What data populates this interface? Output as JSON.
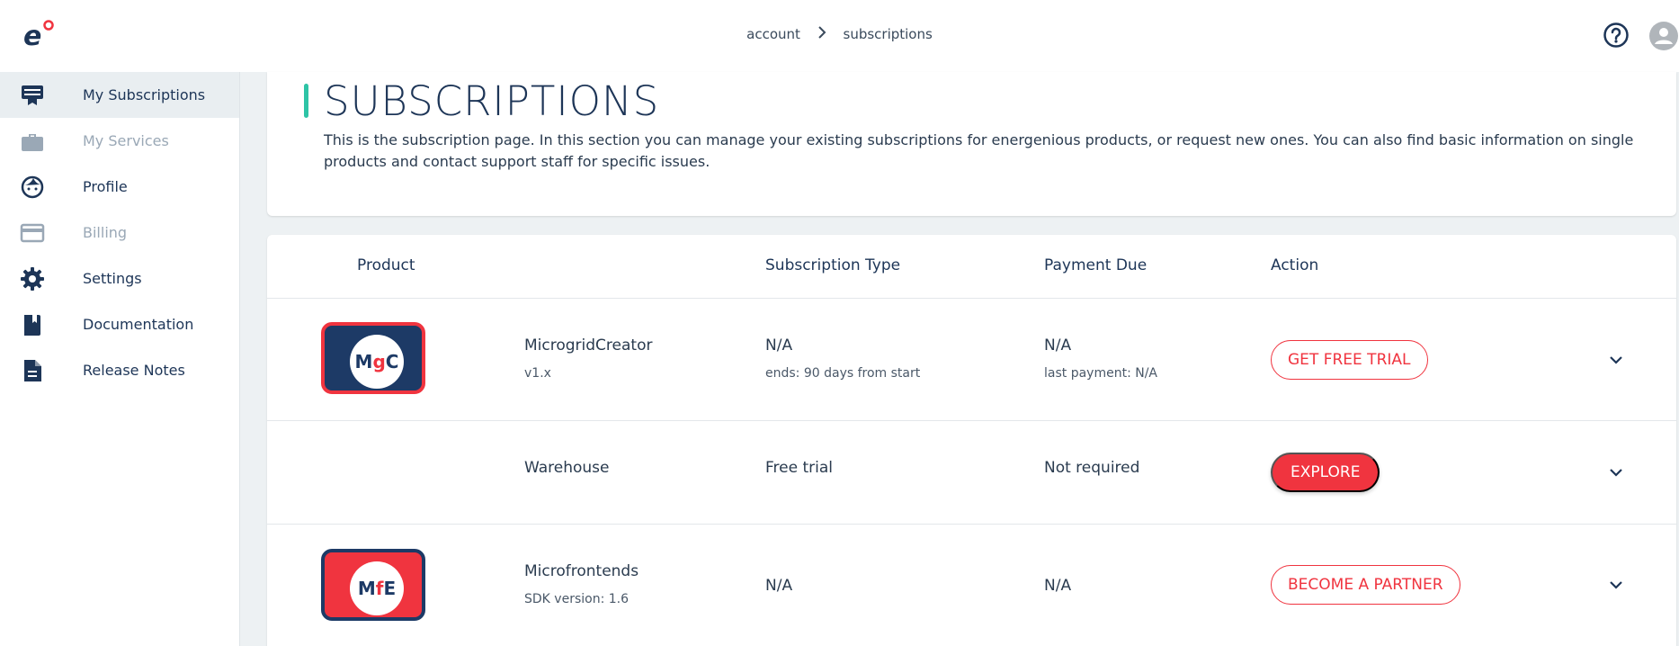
{
  "breadcrumb": {
    "items": [
      "account",
      "subscriptions"
    ]
  },
  "sidebar": {
    "items": [
      {
        "label": "My Subscriptions",
        "icon": "subscriptions-icon",
        "active": true,
        "disabled": false
      },
      {
        "label": "My Services",
        "icon": "briefcase-icon",
        "active": false,
        "disabled": true
      },
      {
        "label": "Profile",
        "icon": "face-icon",
        "active": false,
        "disabled": false
      },
      {
        "label": "Billing",
        "icon": "credit-card-icon",
        "active": false,
        "disabled": true
      },
      {
        "label": "Settings",
        "icon": "gear-icon",
        "active": false,
        "disabled": false
      },
      {
        "label": "Documentation",
        "icon": "book-icon",
        "active": false,
        "disabled": false
      },
      {
        "label": "Release Notes",
        "icon": "document-icon",
        "active": false,
        "disabled": false
      }
    ]
  },
  "header": {
    "title": "SUBSCRIPTIONS",
    "description": "This is the subscription page. In this section you can manage your existing subscriptions for energenious products, or request new ones. You can also find basic information on single products and contact support staff for specific issues."
  },
  "table": {
    "columns": [
      "Product",
      "Subscription Type",
      "Payment Due",
      "Action"
    ],
    "rows": [
      {
        "badge": "MgC",
        "product": "MicrogridCreator",
        "product_sub": "v1.x",
        "type": "N/A",
        "type_sub": "ends: 90 days from start",
        "payment": "N/A",
        "payment_sub": "last payment: N/A",
        "action": "GET FREE TRIAL"
      },
      {
        "badge": "",
        "product": "Warehouse",
        "product_sub": "",
        "type": "Free trial",
        "type_sub": "",
        "payment": "Not required",
        "payment_sub": "",
        "action": "EXPLORE"
      },
      {
        "badge": "MfE",
        "product": "Microfrontends",
        "product_sub": "SDK version: 1.6",
        "type": "N/A",
        "type_sub": "",
        "payment": "N/A",
        "payment_sub": "",
        "action": "BECOME A PARTNER"
      }
    ]
  },
  "colors": {
    "navy": "#1d3557",
    "accent_red": "#f0343f",
    "accent_teal": "#2ec4a6",
    "badge_navy": "#1d3a66"
  }
}
